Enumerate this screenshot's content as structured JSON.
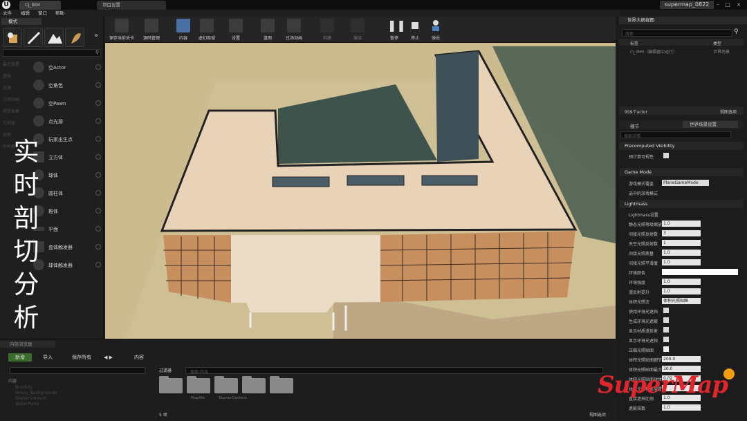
{
  "title_bar": {
    "tabs": [
      "CJ_BIM",
      "项目设置"
    ],
    "project": "supermap_0822",
    "controls": [
      "–",
      "□",
      "×"
    ]
  },
  "menu": [
    "文件",
    "编辑",
    "窗口",
    "帮助"
  ],
  "modes": {
    "tab": "模式",
    "search_placeholder": "",
    "categories": [
      "最近放置",
      "基础",
      "光源",
      "过场动画",
      "视觉效果",
      "几何体",
      "体积",
      "所有类"
    ],
    "items": [
      "空Actor",
      "空角色",
      "空Pawn",
      "点光源",
      "玩家出生点",
      "立方体",
      "球体",
      "圆柱体",
      "椎体",
      "平面",
      "盒体触发器",
      "球体触发器"
    ]
  },
  "overlay_text": [
    "实",
    "时",
    "剖",
    "切",
    "分",
    "析"
  ],
  "toolbar": {
    "buttons": [
      "保存当前关卡",
      "源码管理",
      "内容",
      "虚幻商城",
      "设置",
      "蓝图",
      "过场动画",
      "构建",
      "编译",
      "暂停",
      "停止",
      "弹出"
    ]
  },
  "outliner": {
    "title": "世界大纲视图",
    "search_placeholder": "搜索",
    "col_label": "标签",
    "col_type": "类型",
    "row_label": "CJ_BIM（编辑器中运行）",
    "row_type": "世界场景",
    "count": "959个actor",
    "view_options": "视图选项"
  },
  "details": {
    "tabs": [
      "细节",
      "世界场景设置"
    ],
    "search_placeholder": "搜索详情",
    "sections": {
      "precomputed": "Precomputed Visibility",
      "game_mode": "Game Mode",
      "lightmass": "Lightmass"
    },
    "precomputed_row": "预计算可视性",
    "game_mode_label": "游戏模式覆盖",
    "game_mode_value": "PlaneGameMode",
    "selected_mode": "选中的游戏模式",
    "lightmass_settings": "Lightmass设置",
    "rows": [
      {
        "label": "静态光照等级缩放",
        "value": "1.0"
      },
      {
        "label": "间接光照反射数",
        "value": "3"
      },
      {
        "label": "天空光照反射数",
        "value": "1"
      },
      {
        "label": "间接光照质量",
        "value": "1.0"
      },
      {
        "label": "间接光照平滑度",
        "value": "1.0"
      }
    ],
    "env_color": "环境颜色",
    "rows2": [
      {
        "label": "环境强度",
        "value": "1.0"
      },
      {
        "label": "漫反射提升",
        "value": "1.0"
      }
    ],
    "volume_lighting": "体积光照法",
    "volume_lighting_value": "体积光照贴图",
    "checks": [
      "使用环境光遮挡",
      "生成环境光遮蔽",
      "显示材质漫反射",
      "显示环境光遮挡",
      "压缩光照贴图"
    ],
    "rows3": [
      {
        "label": "体积光照贴图细节",
        "value": "200.0"
      },
      {
        "label": "体积光照贴图最大",
        "value": "30.0"
      },
      {
        "label": "体积光照贴图球体",
        "value": "0.02"
      },
      {
        "label": "体积光源样本放置",
        "value": ""
      },
      {
        "label": "直接遮挡比例",
        "value": "1.0"
      },
      {
        "label": "遮蔽指数",
        "value": "1.0"
      }
    ]
  },
  "content_browser": {
    "title": "内容浏览器",
    "add_new": "新增",
    "import": "导入",
    "save_all": "保存所有",
    "breadcrumb": "内容",
    "filter": "过滤器",
    "search_placeholder": "搜索 内容",
    "tree": [
      "内容",
      "Brushify",
      "Mossy_Backgrounds",
      "StarterContent",
      "WaterPlane"
    ],
    "folders": [
      "",
      "",
      "Mapfile",
      "",
      "StarterContent"
    ],
    "item_count": "5 项",
    "view_options": "视图选项"
  },
  "watermark": "SuperMap"
}
